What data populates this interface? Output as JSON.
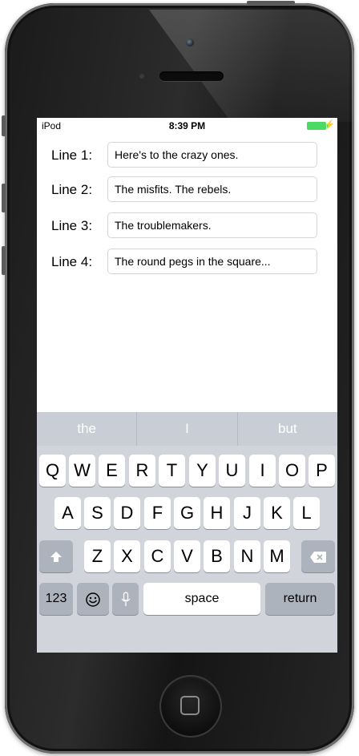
{
  "status_bar": {
    "carrier": "iPod",
    "time": "8:39 PM",
    "charging_icon": "bolt-icon",
    "battery_color": "#4cd964"
  },
  "form": {
    "rows": [
      {
        "label": "Line 1:",
        "value": "Here's to the crazy ones."
      },
      {
        "label": "Line 2:",
        "value": "The misfits. The rebels."
      },
      {
        "label": "Line 3:",
        "value": "The troublemakers."
      },
      {
        "label": "Line 4:",
        "value": "The round pegs in the square..."
      }
    ]
  },
  "keyboard": {
    "predictions": [
      "the",
      "I",
      "but"
    ],
    "row1": [
      "Q",
      "W",
      "E",
      "R",
      "T",
      "Y",
      "U",
      "I",
      "O",
      "P"
    ],
    "row2": [
      "A",
      "S",
      "D",
      "F",
      "G",
      "H",
      "J",
      "K",
      "L"
    ],
    "row3": [
      "Z",
      "X",
      "C",
      "V",
      "B",
      "N",
      "M"
    ],
    "numbers_label": "123",
    "space_label": "space",
    "return_label": "return",
    "shift_icon": "shift-arrow-icon",
    "delete_icon": "delete-icon",
    "emoji_icon": "emoji-icon",
    "mic_icon": "microphone-icon"
  },
  "colors": {
    "keyboard_bg": "#d1d5db",
    "function_key": "#adb3bc",
    "device_body": "#1a1a1a"
  }
}
